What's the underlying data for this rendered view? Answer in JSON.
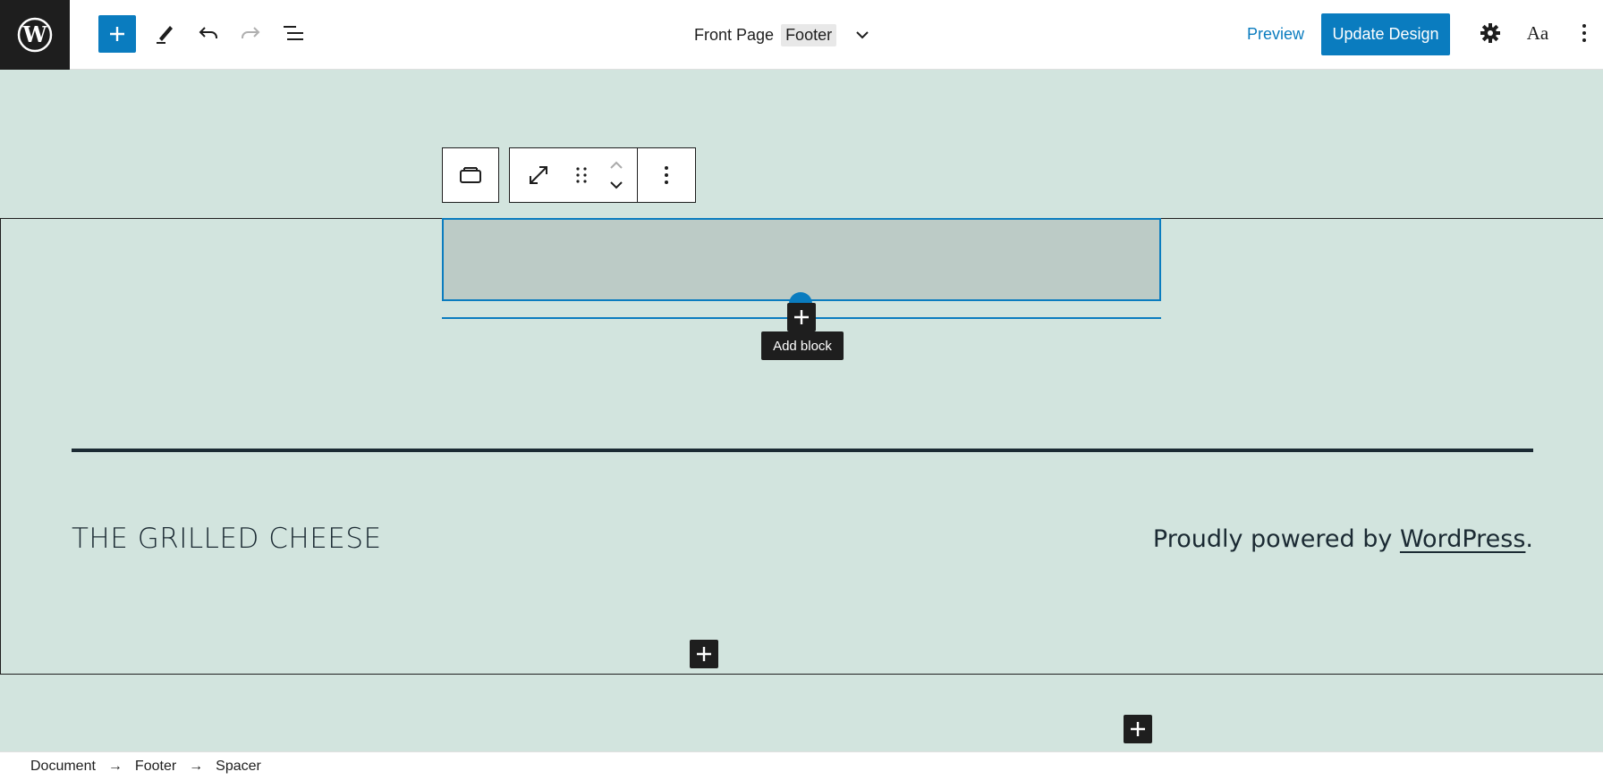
{
  "header": {
    "document_title": "Front Page",
    "template_part_badge": "Footer",
    "preview_label": "Preview",
    "update_label": "Update Design",
    "typography_label": "Aa"
  },
  "canvas": {
    "tooltip": "Add block",
    "site_title": "THE GRILLED CHEESE",
    "powered_prefix": "Proudly powered by ",
    "powered_link": "WordPress",
    "powered_suffix": "."
  },
  "breadcrumb": {
    "items": [
      "Document",
      "Footer",
      "Spacer"
    ],
    "separator": "→"
  },
  "colors": {
    "accent": "#0a7cbf",
    "canvas_bg": "#d2e4de",
    "spacer_bg": "#bccbc6",
    "text_dark": "#1b2a33"
  }
}
